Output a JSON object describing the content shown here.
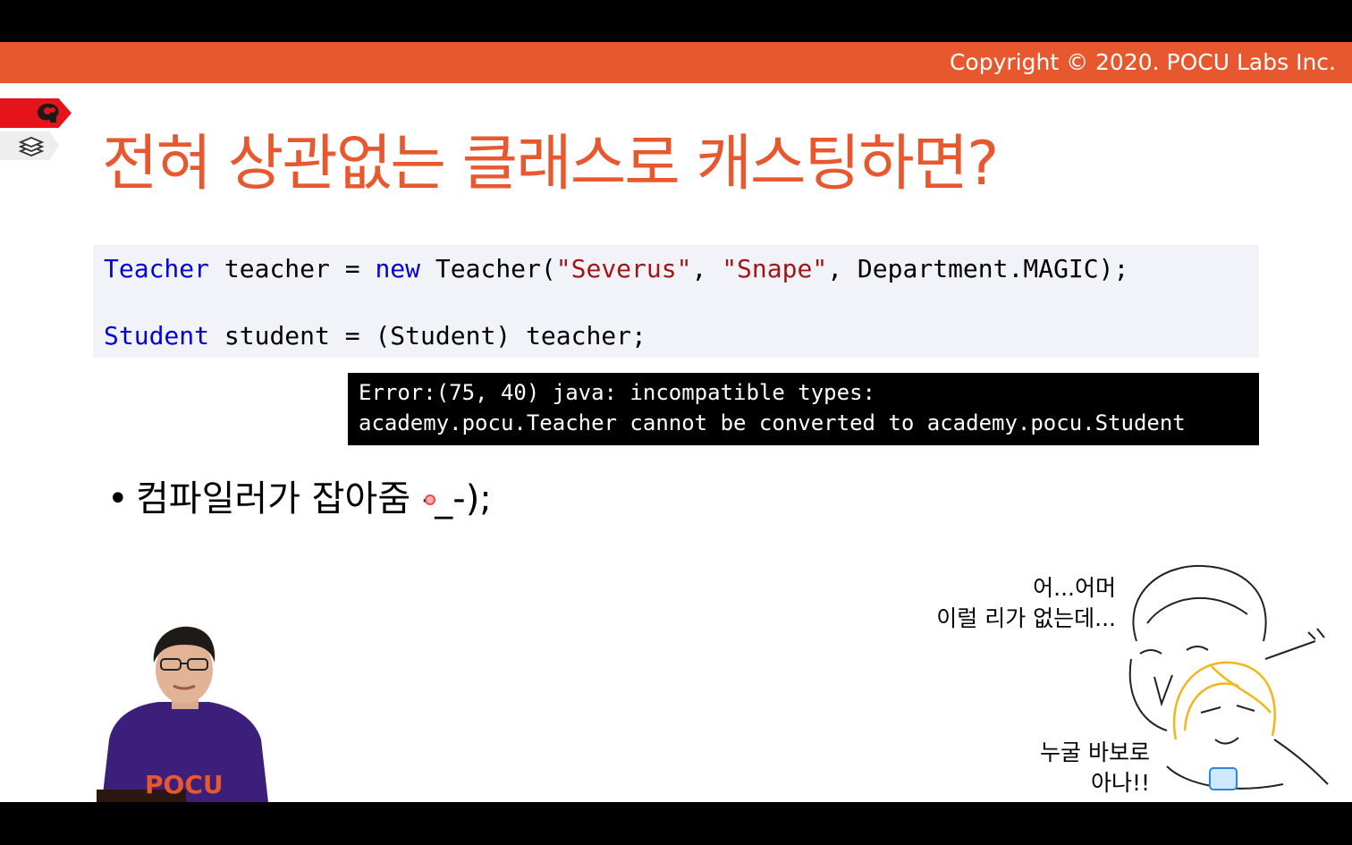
{
  "header": {
    "copyright": "Copyright © 2020. POCU Labs Inc."
  },
  "slide": {
    "title": "전혀 상관없는 클래스로 캐스팅하면?",
    "code": {
      "line1": {
        "type": "Teacher",
        "var": " teacher = ",
        "kw_new": "new",
        "call_start": " Teacher(",
        "str1": "\"Severus\"",
        "sep": ", ",
        "str2": "\"Snape\"",
        "call_end": ", Department.MAGIC);"
      },
      "line2": {
        "type": "Student",
        "rest": " student = (Student) teacher;"
      }
    },
    "error": {
      "line1": "Error:(75, 40) java: incompatible types:",
      "line2": "academy.pocu.Teacher cannot be converted to academy.pocu.Student"
    },
    "bullet": "컴파일러가 잡아줌 -_-);",
    "cartoon": {
      "speech1_line1": "어...어머",
      "speech1_line2": "이럴 리가 없는데...",
      "speech2_line1": "누굴 바보로",
      "speech2_line2": "아나!!"
    },
    "presenter_shirt_text": "POCU"
  },
  "colors": {
    "accent": "#e8582f",
    "tab_red": "#e5141b",
    "code_bg": "#f2f2f9",
    "keyword": "#0000dd",
    "string": "#a31515"
  }
}
